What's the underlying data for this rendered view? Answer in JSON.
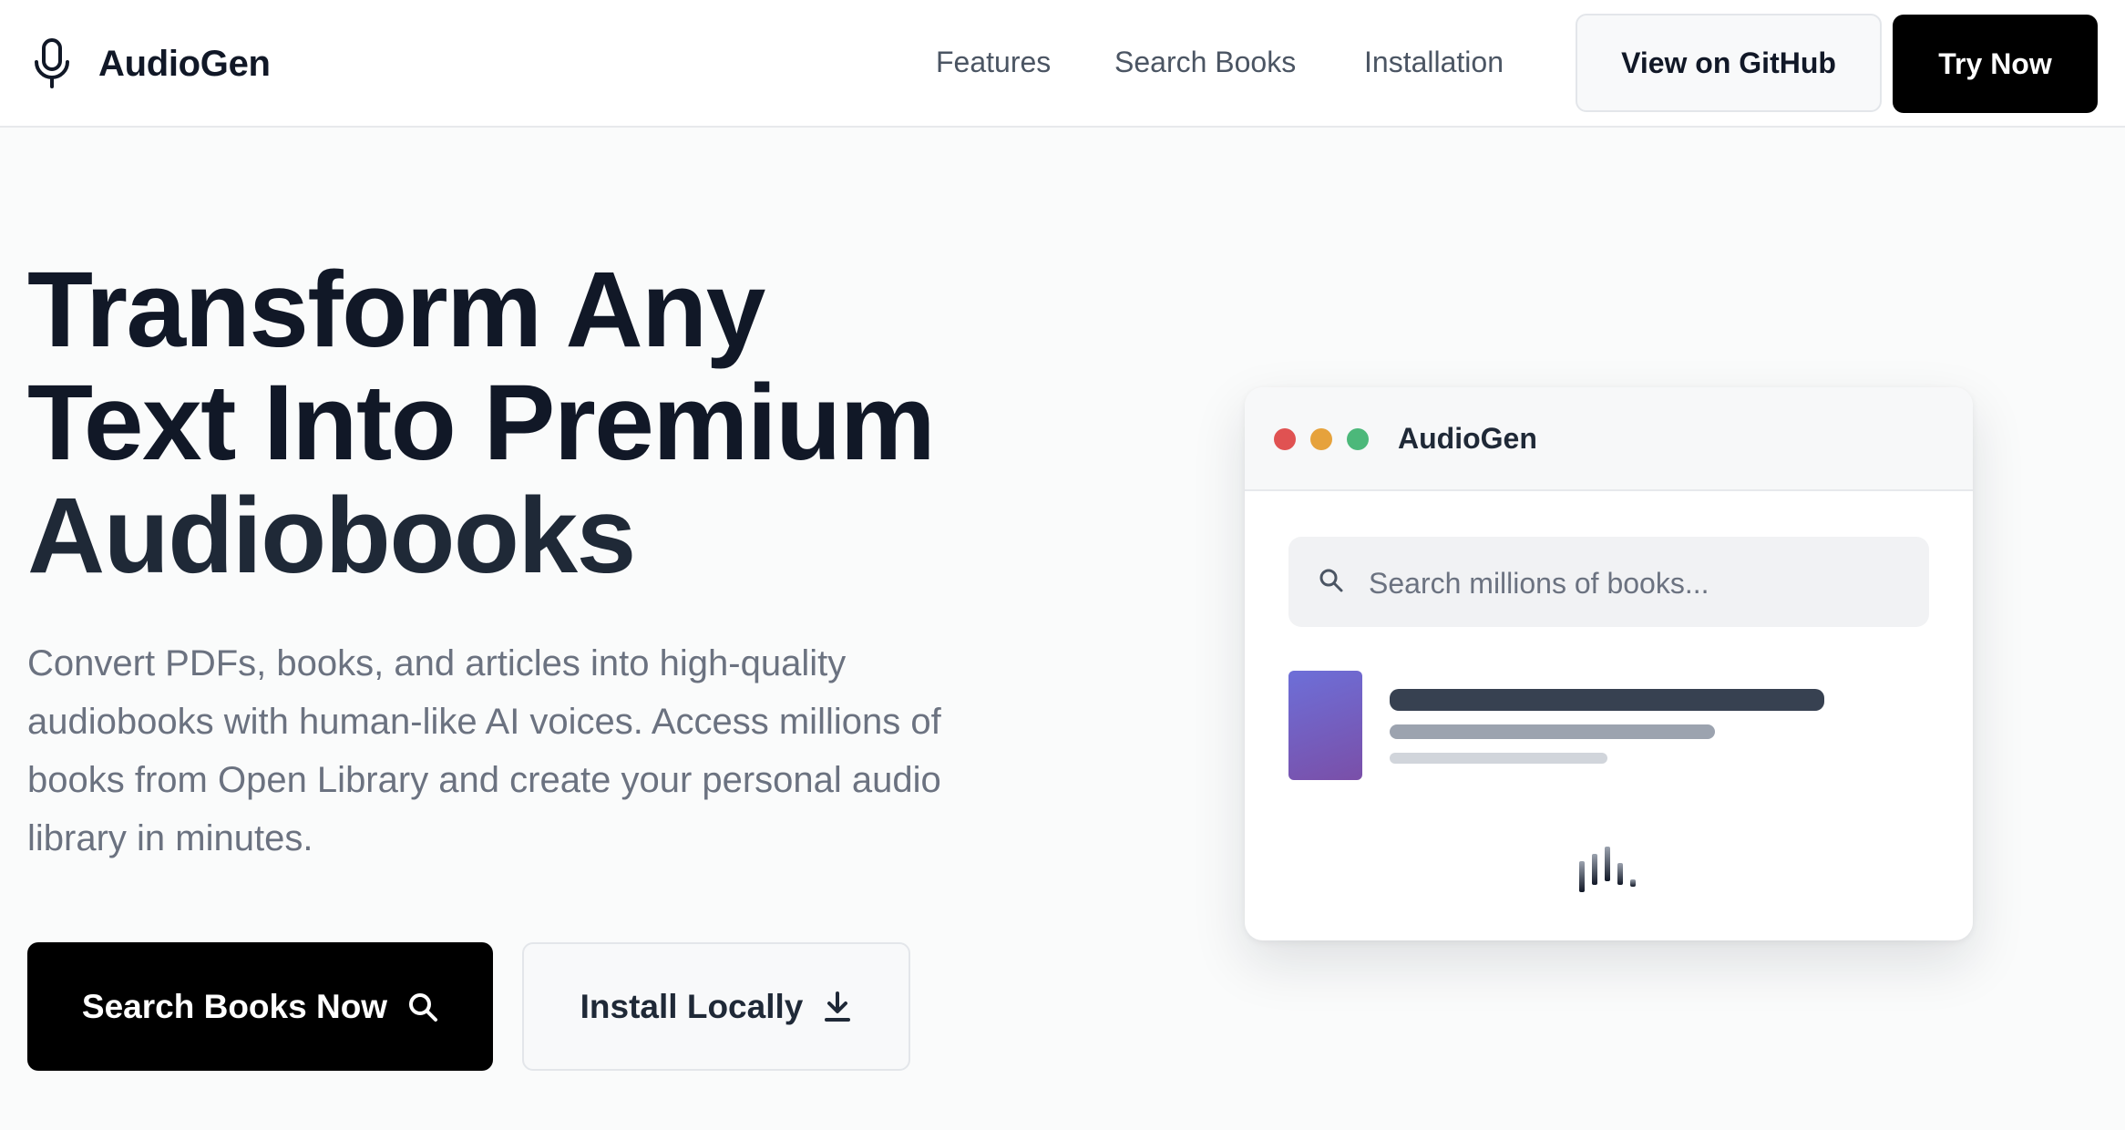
{
  "nav": {
    "brand": "AudioGen",
    "links": [
      "Features",
      "Search Books",
      "Installation"
    ],
    "github_label": "View on GitHub",
    "try_label": "Try Now"
  },
  "hero": {
    "title_lines": [
      "Transform Any",
      "Text Into Premium",
      "Audiobooks"
    ],
    "description": "Convert PDFs, books, and articles into high-quality audiobooks with human-like AI voices. Access millions of books from Open Library and create your personal audio library in minutes.",
    "cta_search": "Search Books Now",
    "cta_install": "Install Locally"
  },
  "mockup": {
    "window_title": "AudioGen",
    "search_placeholder": "Search millions of books..."
  },
  "icons": {
    "brand": "microphone-icon",
    "cta_search": "search-icon",
    "cta_install": "download-icon",
    "mock_search": "search-icon",
    "player": "audio-wave-icon"
  },
  "colors": {
    "primary": "#000000",
    "heading": "#111827",
    "body_text": "#6b7280",
    "dot_red": "#e05252",
    "dot_yellow": "#e6a23c",
    "dot_green": "#4cb87a",
    "cover_gradient_start": "#6d6fd8",
    "cover_gradient_end": "#7a4fa8"
  }
}
